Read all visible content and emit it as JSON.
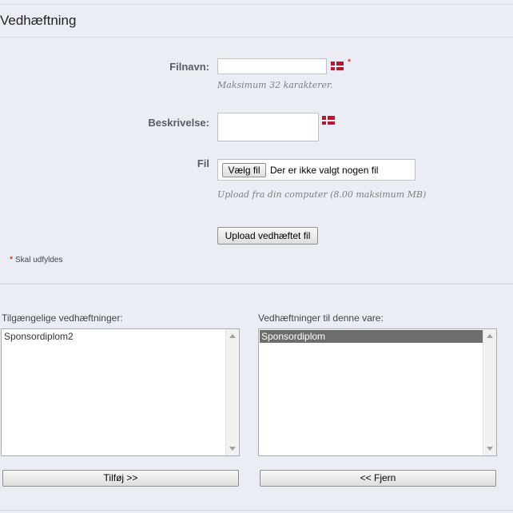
{
  "header": {
    "title": "Vedhæftning"
  },
  "form": {
    "filename": {
      "label": "Filnavn:",
      "value": "",
      "hint": "Maksimum 32 karakterer.",
      "required_mark": "*"
    },
    "description": {
      "label": "Beskrivelse:",
      "value": ""
    },
    "file": {
      "label": "Fil",
      "choose_button": "Vælg fil",
      "status": "Der er ikke valgt nogen fil",
      "hint": "Upload fra din computer (8.00 maksimum MB)"
    },
    "upload_button": "Upload vedhæftet fil",
    "required_note": {
      "mark": "*",
      "text": "Skal udfyldes"
    }
  },
  "lists": {
    "available": {
      "label": "Tilgængelige vedhæftninger:",
      "items": [
        "Sponsordiplom2"
      ]
    },
    "assigned": {
      "label": "Vedhæftninger til denne vare:",
      "items": [
        "Sponsordiplom"
      ],
      "selected": "Sponsordiplom"
    },
    "add_button": "Tilføj >>",
    "remove_button": "<< Fjern"
  },
  "colors": {
    "flag_red": "#c8102e",
    "required_red": "#cc0000",
    "selected_bg": "#6d6d6d"
  },
  "icons": {
    "language_flag": "danish-flag-icon"
  }
}
